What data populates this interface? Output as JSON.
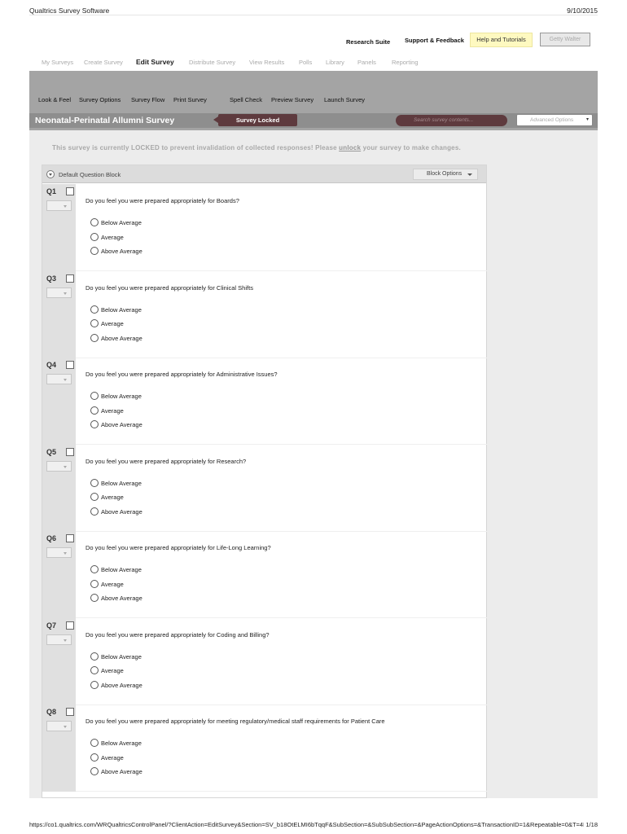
{
  "print": {
    "title": "Qualtrics Survey Software",
    "date": "9/10/2015",
    "url": "https://co1.qualtrics.com/WRQualtricsControlPanel/?ClientAction=EditSurvey&Section=SV_b18OtELMI6bTqqF&SubSection=&SubSubSection=&PageActionOptions=&TransactionID=1&Repeatable=0&T=4B",
    "page": "1/18"
  },
  "utility": {
    "research_suite": "Research Suite",
    "support": "Support & Feedback",
    "help": "Help and Tutorials",
    "user": "Getty Walter"
  },
  "main_nav": [
    "My Surveys",
    "Create Survey",
    "Edit Survey",
    "Distribute Survey",
    "View Results",
    "Polls",
    "Library",
    "Panels",
    "Reporting"
  ],
  "toolbar": [
    "Look & Feel",
    "Survey Options",
    "Survey Flow",
    "Print Survey",
    "Spell Check",
    "Preview Survey",
    "Launch Survey"
  ],
  "survey": {
    "title": "Neonatal-Perinatal Allumni Survey",
    "status": "Survey Locked",
    "search_placeholder": "Search survey contents...",
    "advanced": "Advanced Options"
  },
  "notice": {
    "before": "This survey is currently LOCKED to prevent invalidation of collected responses! Please ",
    "link": "unlock",
    "after": " your survey to make changes."
  },
  "block": {
    "title": "Default Question Block",
    "options": "Block Options"
  },
  "questions": [
    {
      "id": "Q1",
      "text": "Do you feel you were prepared appropriately for Boards?",
      "options": [
        "Below Average",
        "Average",
        "Above Average"
      ]
    },
    {
      "id": "Q3",
      "text": "Do you feel you were prepared appropriately for Clinical Shifts",
      "options": [
        "Below Average",
        "Average",
        "Above Average"
      ]
    },
    {
      "id": "Q4",
      "text": "Do you feel you were prepared appropriately for Administrative Issues?",
      "options": [
        "Below Average",
        "Average",
        "Above Average"
      ]
    },
    {
      "id": "Q5",
      "text": "Do you feel you were prepared appropriately for Research?",
      "options": [
        "Below Average",
        "Average",
        "Above Average"
      ]
    },
    {
      "id": "Q6",
      "text": "Do you feel you were prepared appropriately for Life-Long Learning?",
      "options": [
        "Below Average",
        "Average",
        "Above Average"
      ]
    },
    {
      "id": "Q7",
      "text": "Do you feel you were prepared appropriately for Coding and Billing?",
      "options": [
        "Below Average",
        "Average",
        "Above Average"
      ]
    },
    {
      "id": "Q8",
      "text": "Do you feel you were prepared appropriately for meeting regulatory/medical staff requirements for Patient Care",
      "options": [
        "Below Average",
        "Average",
        "Above Average"
      ]
    }
  ]
}
